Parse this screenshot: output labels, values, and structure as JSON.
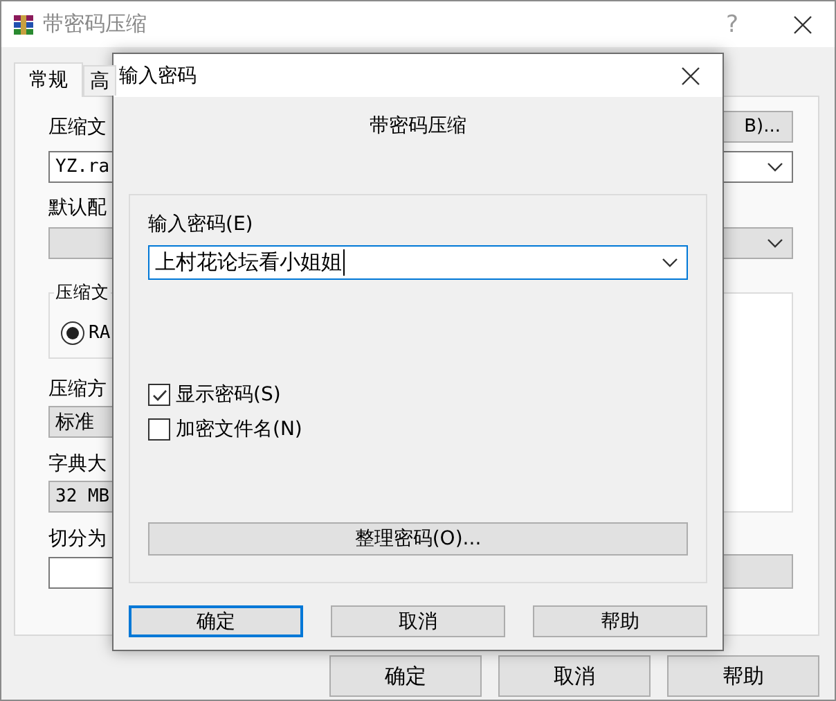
{
  "window": {
    "title": "带密码压缩",
    "help_button": "?"
  },
  "tabs": [
    {
      "label": "常规",
      "selected": true
    },
    {
      "label": "高",
      "selected": false
    }
  ],
  "general": {
    "archive_name_label": "压缩文",
    "browse_button": "B)...",
    "archive_name_value": "YZ.ra",
    "profile_label": "默认配",
    "format_group_label": "压缩文",
    "format_option": {
      "label": "RA",
      "selected": true
    },
    "method_label": "压缩方",
    "method_value": "标准",
    "dictionary_label": "字典大",
    "dictionary_value": "32 MB",
    "split_label": "切分为"
  },
  "buttons": [
    "确定",
    "取消",
    "帮助"
  ],
  "dialog": {
    "title": "输入密码",
    "heading": "带密码压缩",
    "password_label": "输入密码(E)",
    "password_value": "上村花论坛看小姐姐",
    "options": [
      {
        "label": "显示密码(S)",
        "checked": true
      },
      {
        "label": "加密文件名(N)",
        "checked": false
      }
    ],
    "organize_button": "整理密码(O)...",
    "buttons": [
      {
        "label": "确定",
        "focused": true
      },
      {
        "label": "取消",
        "focused": false
      },
      {
        "label": "帮助",
        "focused": false
      }
    ]
  }
}
